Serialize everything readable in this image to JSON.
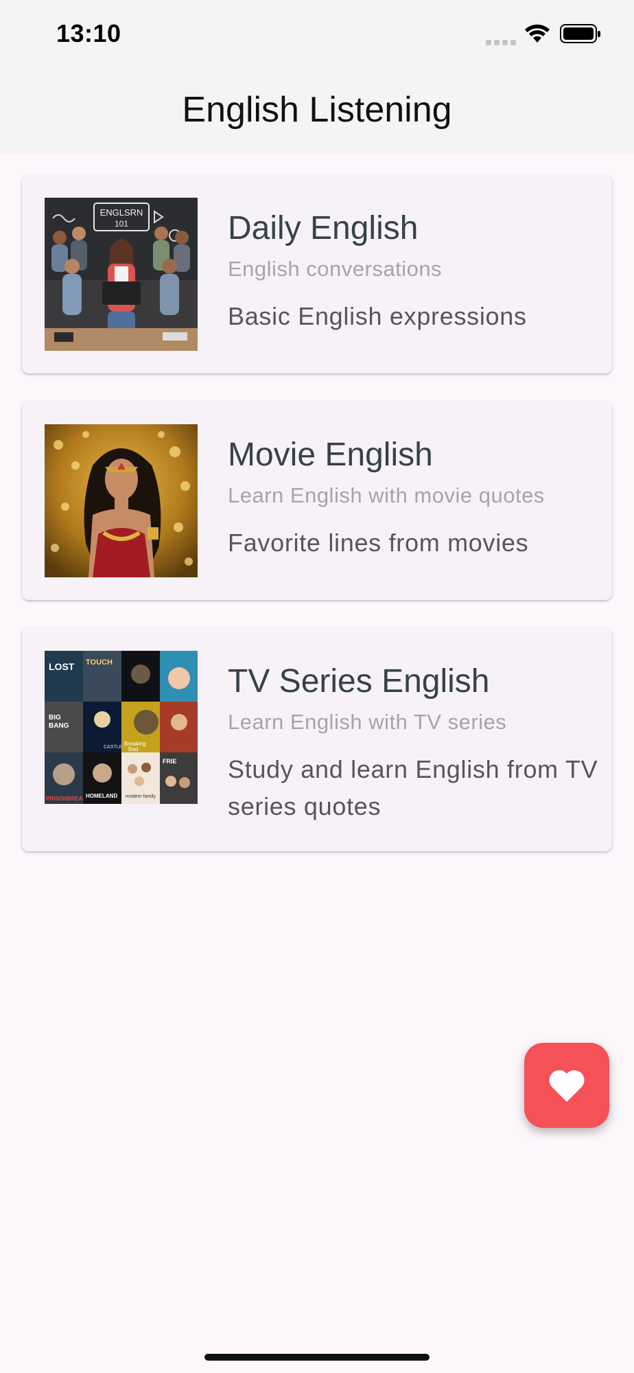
{
  "status_bar": {
    "time": "13:10",
    "icons": [
      "signal-icon",
      "wifi-icon",
      "battery-icon"
    ]
  },
  "app_bar": {
    "title": "English Listening"
  },
  "cards": [
    {
      "title": "Daily English",
      "subtitle": "English conversations",
      "description": "Basic English expressions",
      "image": "daily-english-classroom-image",
      "image_text": "ENGLSRN 101"
    },
    {
      "title": "Movie English",
      "subtitle": "Learn English with movie quotes",
      "description": "Favorite lines from movies",
      "image": "movie-heroine-image"
    },
    {
      "title": "TV Series English",
      "subtitle": "Learn English with TV series",
      "description": "Study and learn English from TV series quotes",
      "image": "tv-series-posters-collage-image",
      "image_text": [
        "LOST",
        "TOUCH",
        "BIG BANG",
        "Breaking Bad",
        "CASTLE",
        "PRISON BREAK",
        "HOMELAND",
        "modern family",
        "FRIENDS"
      ]
    }
  ],
  "fab": {
    "icon": "heart-icon",
    "color": "#f45257"
  },
  "colors": {
    "background": "#fdf7fc",
    "app_bar": "#f4f4f6",
    "card": "#f6f2f7",
    "title_text": "#37414b"
  }
}
